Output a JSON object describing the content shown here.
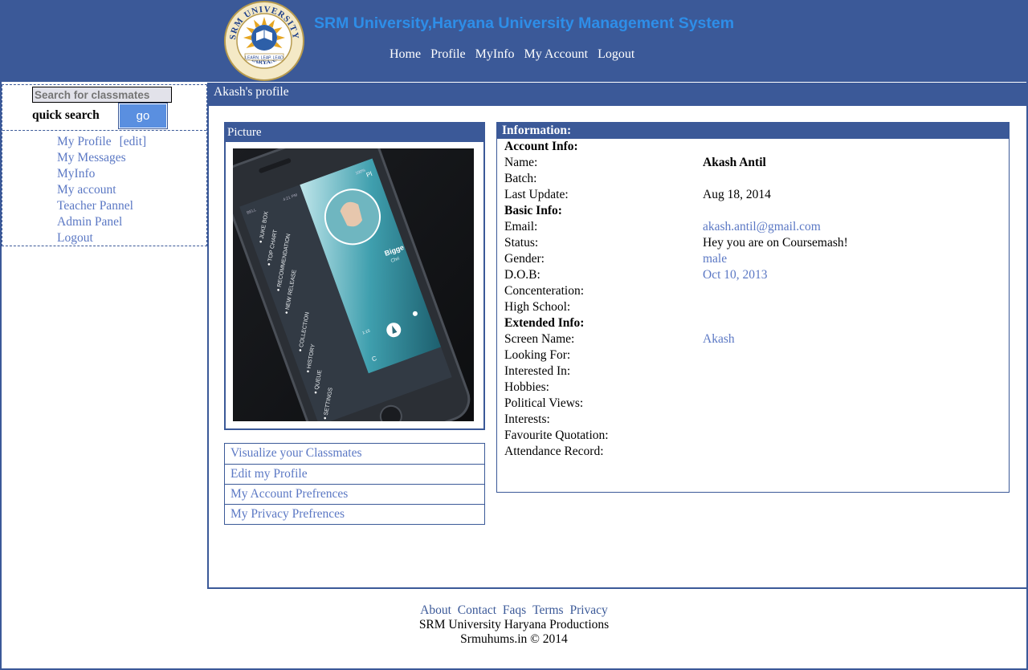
{
  "header": {
    "site_title": "SRM University,Haryana University Management System",
    "logo": {
      "icon": "srm-university-seal",
      "top_text": "SRM UNIVERSITY",
      "bottom_text": "HARYANA",
      "motto": "LEARN. LEAP. LEAD"
    },
    "nav": [
      "Home",
      "Profile",
      "MyInfo",
      "My Account",
      "Logout"
    ]
  },
  "sidebar": {
    "search_placeholder": "Search for classmates",
    "quick_search_label": "quick search",
    "go_label": "go",
    "menu": {
      "my_profile": "My Profile",
      "edit": "[edit]",
      "my_messages": "My Messages",
      "my_info": "MyInfo",
      "my_account": "My account",
      "teacher_panel": "Teacher Pannel",
      "admin_panel": "Admin Panel",
      "logout": "Logout"
    }
  },
  "main": {
    "title": "Akash's profile",
    "picture": {
      "heading": "Picture",
      "status_bar": {
        "carrier": "BELL",
        "time": "4:21 PM",
        "battery": "100%"
      },
      "menu_items": [
        "JUKE BOX",
        "TOP CHART",
        "RECOMMENDATION",
        "NEW RELEASE",
        "COLLECTION",
        "HISTORY",
        "QUEUE",
        "SETTINGS"
      ],
      "card_text": {
        "title": "Bigge",
        "sub": "Chri",
        "time": "1:15",
        "initial": "C",
        "corner": "Pl"
      }
    },
    "links": [
      "Visualize your Classmates",
      "Edit my Profile",
      "My Account Prefrences",
      "My Privacy Prefrences"
    ],
    "information": {
      "heading": "Information:",
      "account_info": "Account Info:",
      "name_label": "Name:",
      "name_value": "Akash Antil",
      "batch_label": "Batch:",
      "last_update_label": "Last Update:",
      "last_update_value": "Aug 18, 2014",
      "basic_info": "Basic Info:",
      "email_label": "Email:",
      "email_value": "akash.antil@gmail.com",
      "status_label": "Status:",
      "status_value": "Hey you are on Coursemash!",
      "gender_label": "Gender:",
      "gender_value": "male",
      "dob_label": "D.O.B:",
      "dob_value": "Oct 10, 2013",
      "concentration_label": "Concenteration:",
      "high_school_label": "High School:",
      "extended_info": "Extended Info:",
      "screen_name_label": "Screen Name:",
      "screen_name_value": "Akash",
      "looking_for_label": "Looking For:",
      "interested_in_label": "Interested In:",
      "hobbies_label": "Hobbies:",
      "political_views_label": "Political Views:",
      "interests_label": "Interests:",
      "favourite_quotation_label": "Favourite Quotation:",
      "attendance_label": "Attendance Record:"
    }
  },
  "footer": {
    "links": [
      "About",
      "Contact",
      "Faqs",
      "Terms",
      "Privacy"
    ],
    "line1": "SRM University Haryana Productions",
    "line2": "Srmuhums.in © 2014"
  },
  "colors": {
    "header_bg": "#3b5998",
    "title_blue": "#2e8ee8",
    "link_blue": "#5b78c4",
    "button_blue": "#5a8fe0"
  }
}
